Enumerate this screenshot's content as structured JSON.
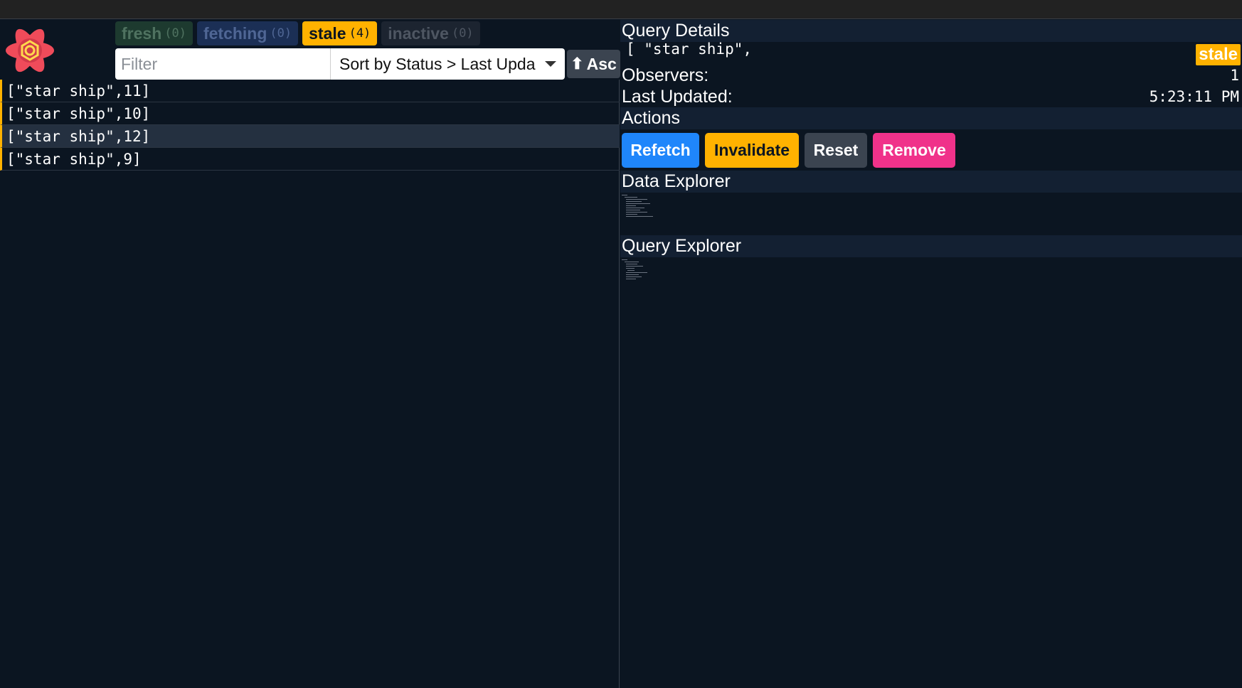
{
  "colors": {
    "accent_stale": "#ffb200",
    "fresh": "#1d3a2f",
    "fetching": "#1b2f55",
    "inactive": "#1c2430",
    "refetch": "#1f86fb",
    "remove": "#f0328a",
    "panel": "#0b1521"
  },
  "logo": {
    "icon": "react-query-logo-icon"
  },
  "status_badges": [
    {
      "label": "fresh",
      "count": "(0)"
    },
    {
      "label": "fetching",
      "count": "(0)"
    },
    {
      "label": "stale",
      "count": "(4)"
    },
    {
      "label": "inactive",
      "count": "(0)"
    }
  ],
  "filter": {
    "placeholder": "Filter",
    "value": ""
  },
  "sort": {
    "selected": "Sort by Status > Last Upda"
  },
  "order_button": {
    "icon": "arrow-up-icon",
    "label": "Asc"
  },
  "queries": [
    {
      "key": "[\"star ship\",11]"
    },
    {
      "key": "[\"star ship\",10]"
    },
    {
      "key": "[\"star ship\",12]"
    },
    {
      "key": "[\"star ship\",9]"
    }
  ],
  "details": {
    "heading": "Query Details",
    "key_text": "[ \"star ship\",",
    "status": "stale",
    "observers_label": "Observers:",
    "observers_value": "1",
    "last_updated_label": "Last Updated:",
    "last_updated_value": "5:23:11 PM"
  },
  "actions": {
    "heading": "Actions",
    "refetch": "Refetch",
    "invalidate": "Invalidate",
    "reset": "Reset",
    "remove": "Remove"
  },
  "data_explorer": {
    "heading": "Data Explorer"
  },
  "query_explorer": {
    "heading": "Query Explorer"
  }
}
